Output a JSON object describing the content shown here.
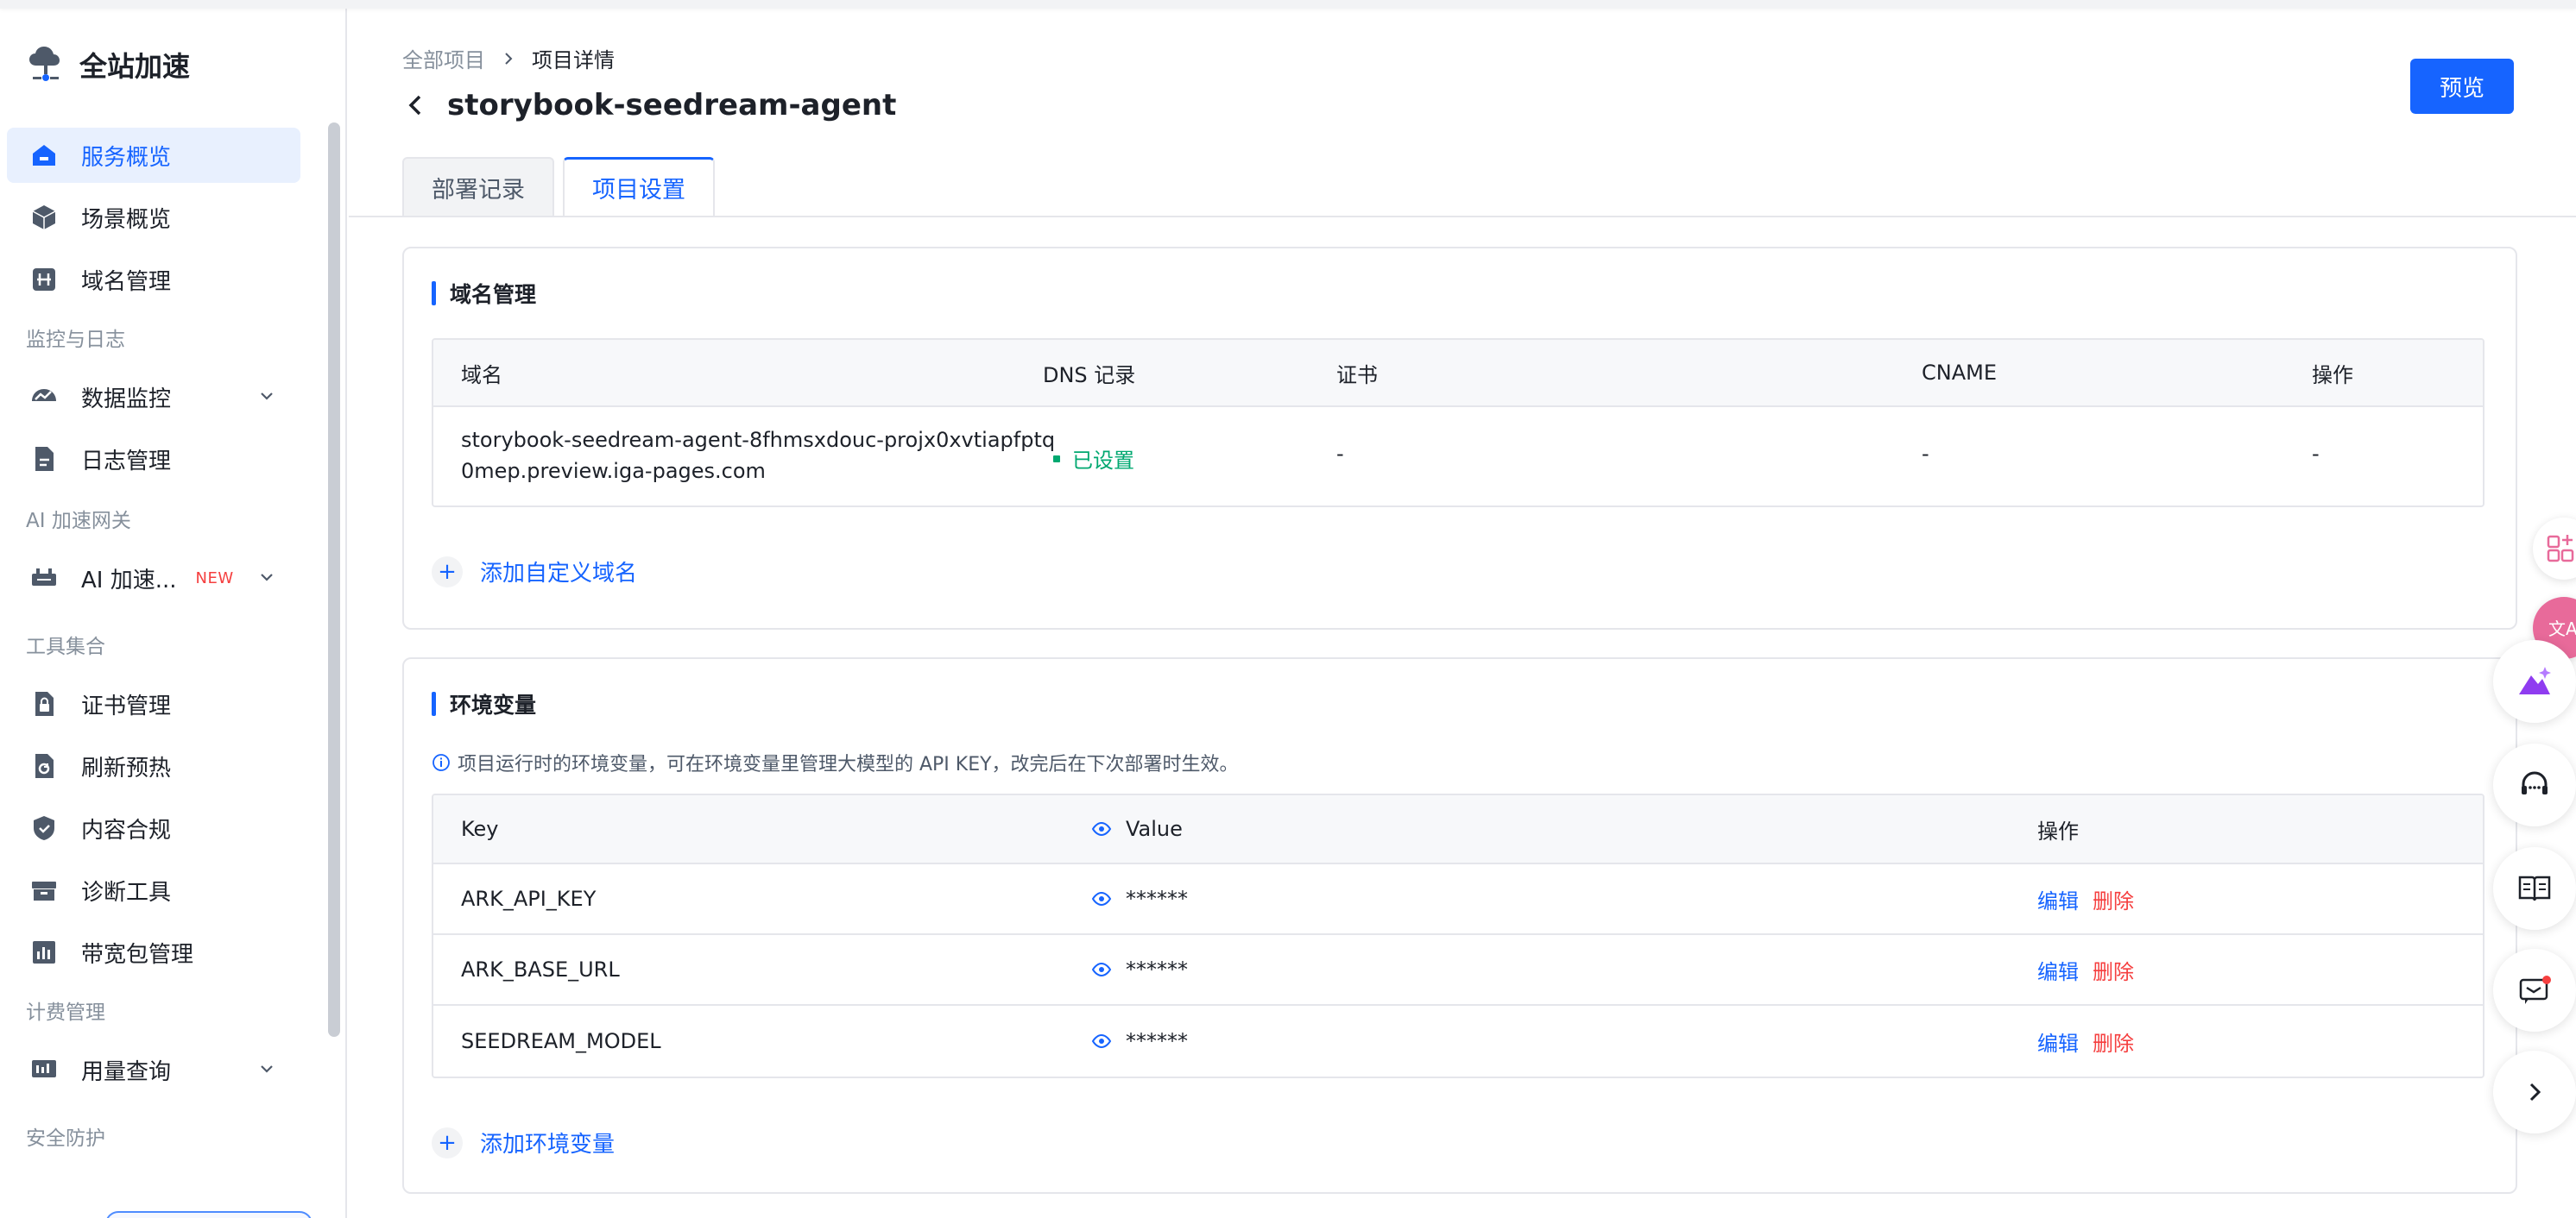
{
  "app": {
    "title": "全站加速"
  },
  "sidebar": {
    "items": [
      {
        "label": "服务概览",
        "icon": "home-icon",
        "active": true
      },
      {
        "label": "场景概览",
        "icon": "cube-icon"
      },
      {
        "label": "域名管理",
        "icon": "domain-icon"
      },
      {
        "label": "数据监控",
        "icon": "monitor-chart-icon",
        "expandable": true
      },
      {
        "label": "日志管理",
        "icon": "document-icon"
      },
      {
        "label": "AI 加速...",
        "icon": "ai-gateway-icon",
        "badge": "NEW",
        "expandable": true
      },
      {
        "label": "证书管理",
        "icon": "lock-icon"
      },
      {
        "label": "刷新预热",
        "icon": "refresh-icon"
      },
      {
        "label": "内容合规",
        "icon": "shield-icon"
      },
      {
        "label": "诊断工具",
        "icon": "toolbox-icon"
      },
      {
        "label": "带宽包管理",
        "icon": "bar-chart-icon"
      },
      {
        "label": "用量查询",
        "icon": "usage-icon",
        "expandable": true
      }
    ],
    "groups": {
      "monitor": "监控与日志",
      "ai": "AI 加速网关",
      "tools": "工具集合",
      "billing": "计费管理",
      "security": "安全防护"
    }
  },
  "breadcrumb": {
    "root": "全部项目",
    "current": "项目详情"
  },
  "page": {
    "title": "storybook-seedream-agent",
    "preview_label": "预览"
  },
  "tabs": [
    {
      "label": "部署记录",
      "active": false
    },
    {
      "label": "项目设置",
      "active": true
    }
  ],
  "domain_card": {
    "title": "域名管理",
    "columns": [
      "域名",
      "DNS 记录",
      "证书",
      "CNAME",
      "操作"
    ],
    "rows": [
      {
        "domain_line1": "storybook-seedream-agent-8fhmsxdouc-projx0xvtiapfptq",
        "domain_line2": "0mep.preview.iga-pages.com",
        "dns": "已设置",
        "cert": "-",
        "cname": "-",
        "action": "-"
      }
    ],
    "add_label": "添加自定义域名"
  },
  "env_card": {
    "title": "环境变量",
    "info": "项目运行时的环境变量，可在环境变量里管理大模型的 API KEY，改完后在下次部署时生效。",
    "columns": {
      "key": "Key",
      "value": "Value",
      "actions": "操作"
    },
    "rows": [
      {
        "key": "ARK_API_KEY",
        "value": "******",
        "edit": "编辑",
        "delete": "删除"
      },
      {
        "key": "ARK_BASE_URL",
        "value": "******",
        "edit": "编辑",
        "delete": "删除"
      },
      {
        "key": "SEEDREAM_MODEL",
        "value": "******",
        "edit": "编辑",
        "delete": "删除"
      }
    ],
    "add_label": "添加环境变量"
  },
  "colors": {
    "accent": "#1664ff",
    "danger": "#f53f3f",
    "success": "#00a870"
  }
}
